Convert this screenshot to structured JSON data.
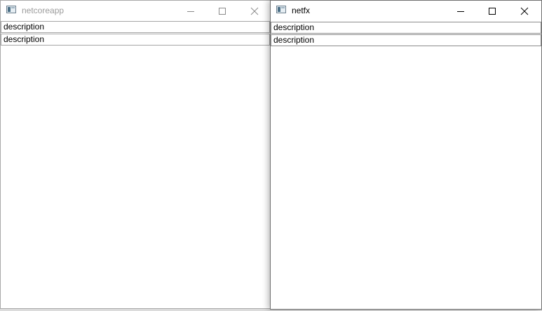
{
  "windows": [
    {
      "title": "netcoreapp",
      "active": false,
      "rows": [
        "description",
        "description"
      ]
    },
    {
      "title": "netfx",
      "active": true,
      "rows": [
        "description",
        "description"
      ]
    }
  ],
  "icons": {
    "app": "app-window-icon",
    "minimize": "minimize-icon",
    "maximize": "maximize-icon",
    "close": "close-icon"
  },
  "colors": {
    "inactive_title": "#9b9b9b",
    "active_title": "#000000",
    "window_bg": "#ffffff"
  }
}
